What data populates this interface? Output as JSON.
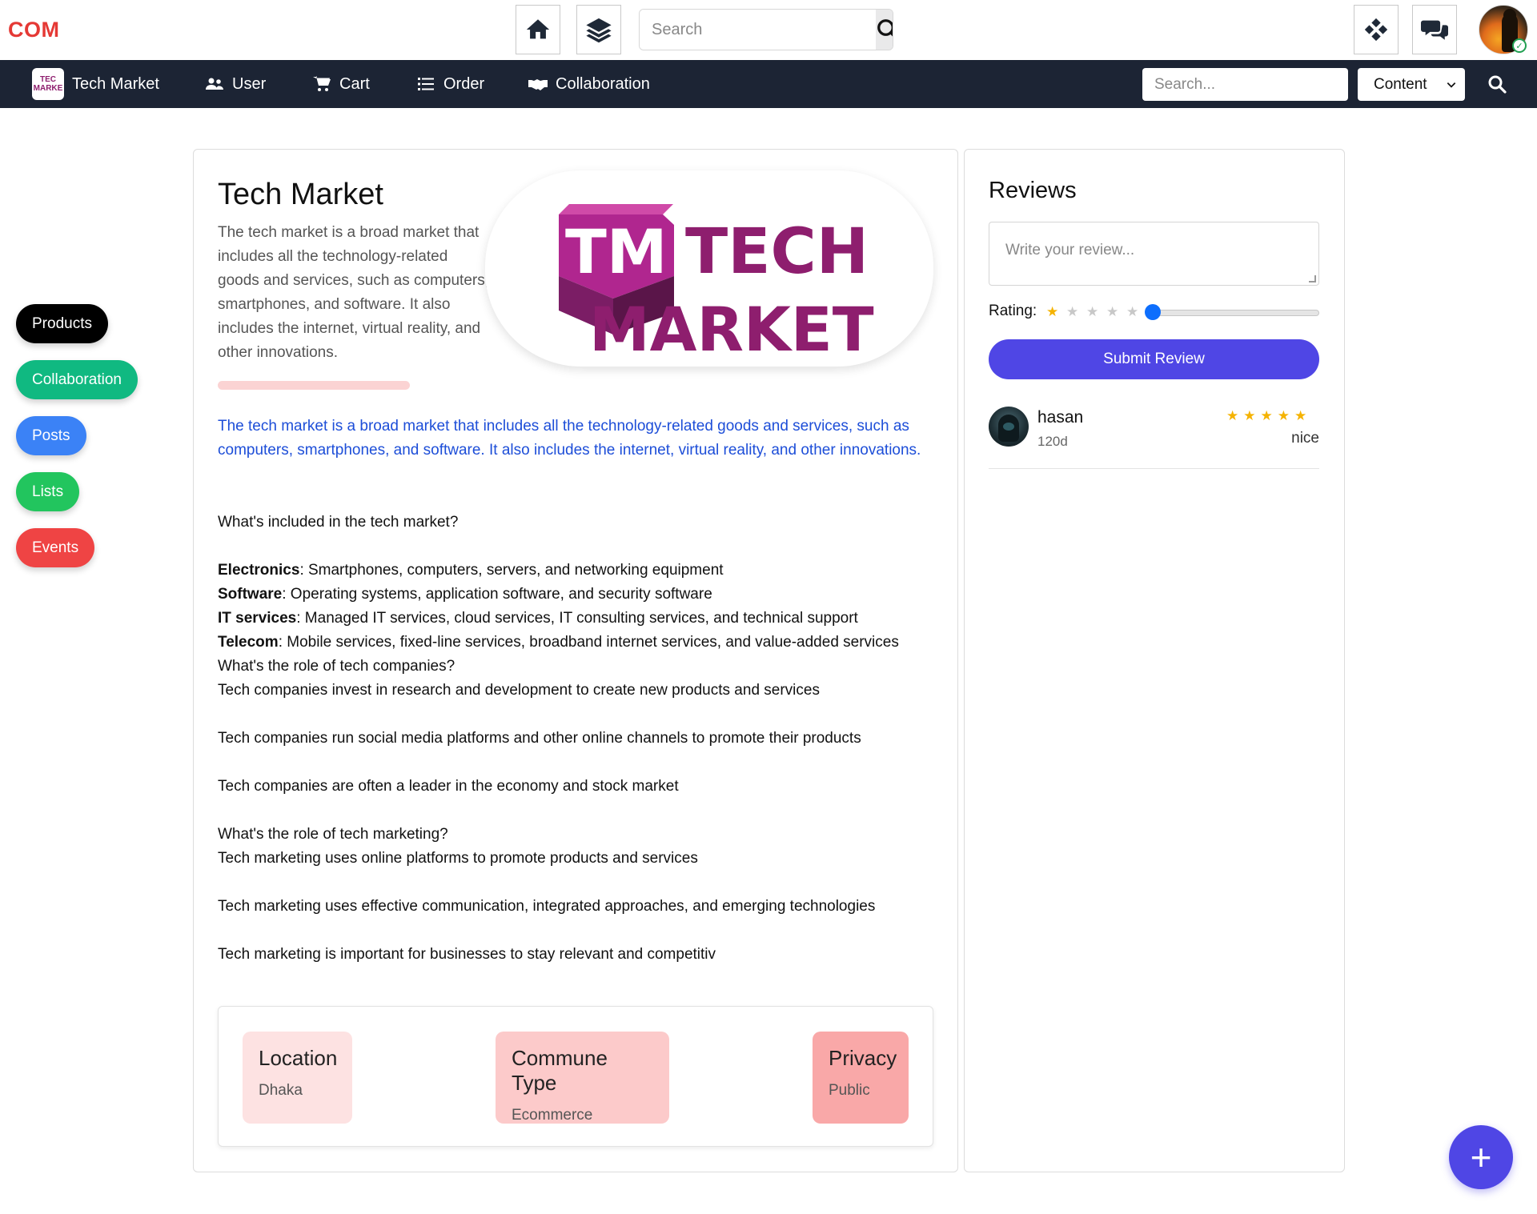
{
  "topbar": {
    "brand": "COM",
    "search_placeholder": "Search",
    "icons": [
      "home-icon",
      "layers-icon",
      "search-icon",
      "dice-icon",
      "chat-icon",
      "avatar"
    ]
  },
  "navbar": {
    "logo_text": [
      "TEC",
      "MARKE"
    ],
    "items": [
      {
        "label": "Tech Market",
        "icon": "logo"
      },
      {
        "label": "User",
        "icon": "users-icon"
      },
      {
        "label": "Cart",
        "icon": "cart-icon"
      },
      {
        "label": "Order",
        "icon": "list-icon"
      },
      {
        "label": "Collaboration",
        "icon": "handshake-icon"
      }
    ],
    "search_placeholder": "Search...",
    "select_value": "Content"
  },
  "pills": [
    {
      "label": "Products",
      "color": "#000000"
    },
    {
      "label": "Collaboration",
      "color": "#10b981"
    },
    {
      "label": "Posts",
      "color": "#3b82f6"
    },
    {
      "label": "Lists",
      "color": "#22c55e"
    },
    {
      "label": "Events",
      "color": "#ef4444"
    }
  ],
  "main": {
    "title": "Tech Market",
    "intro": "The tech market is a broad market that includes all the technology-related goods and services, such as computers, smartphones, and software. It also includes the internet, virtual reality, and other innovations.",
    "logo": {
      "tm": "TM",
      "word1": "TECH",
      "word2": "MARKET"
    },
    "blue_desc": "The tech market is a broad market that includes all the technology-related goods and services, such as computers, smartphones, and software. It also includes the internet, virtual reality, and other innovations.",
    "q1": "What's included in the tech market?",
    "categories": [
      {
        "name": "Electronics",
        "text": ": Smartphones, computers, servers, and networking equipment"
      },
      {
        "name": "Software",
        "text": ": Operating systems, application software, and security software"
      },
      {
        "name": "IT services",
        "text": ": Managed IT services, cloud services, IT consulting services, and technical support"
      },
      {
        "name": "Telecom",
        "text": ": Mobile services, fixed-line services, broadband internet services, and value-added services"
      }
    ],
    "q2": "What's the role of tech companies?",
    "p1": "Tech companies invest in research and development to create new products and services",
    "p2": "Tech companies run social media platforms and other online channels to promote their products",
    "p3": "Tech companies are often a leader in the economy and stock market",
    "q3": "What's the role of tech marketing?",
    "p4": "Tech marketing uses online platforms to promote products and services",
    "p5": "Tech marketing uses effective communication, integrated approaches, and emerging technologies",
    "p6": "Tech marketing is important for businesses to stay relevant and competitiv",
    "info": [
      {
        "title": "Location",
        "value": "Dhaka",
        "color": "#fde2e2"
      },
      {
        "title": "Commune Type",
        "value": "Ecommerce",
        "color": "#fccaca"
      },
      {
        "title": "Privacy",
        "value": "Public",
        "color": "#f9a8a8"
      }
    ]
  },
  "reviews": {
    "title": "Reviews",
    "placeholder": "Write your review...",
    "rating_label": "Rating:",
    "rating_value": 1,
    "rating_max": 5,
    "submit_label": "Submit Review",
    "items": [
      {
        "name": "hasan",
        "time": "120d",
        "stars": 5,
        "text": "nice"
      }
    ]
  },
  "fab_label": "+"
}
